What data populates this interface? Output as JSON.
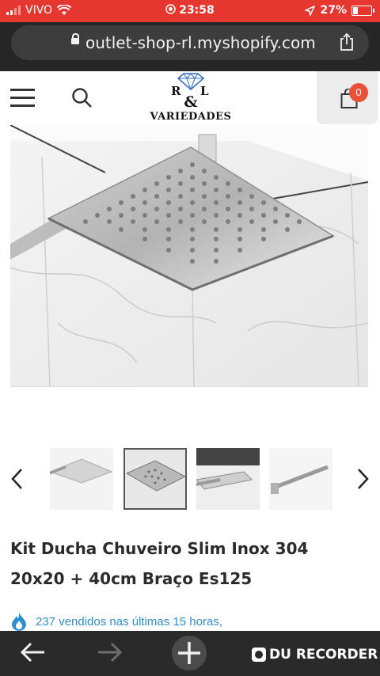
{
  "status_bar": {
    "carrier": "VIVO",
    "time": "23:58",
    "battery": "27%"
  },
  "browser": {
    "url": "outlet-shop-rl.myshopify.com"
  },
  "header": {
    "logo_r": "R",
    "logo_l": "L",
    "logo_amp": "&",
    "logo_name": "VARIEDADES",
    "cart_count": "0"
  },
  "product": {
    "title_line1": "Kit Ducha Chuveiro Slim Inox 304",
    "title_line2": "20x20 + 40cm Braço Es125",
    "sold_text": "237 vendidos nas últimas 15 horas,",
    "thumbnail_count": 4
  },
  "overlay": {
    "recorder_label": "DU RECORDER"
  },
  "colors": {
    "status_bar": "#e5362f",
    "cart_badge": "#e8503a",
    "sold_text": "#2f8fd0"
  }
}
